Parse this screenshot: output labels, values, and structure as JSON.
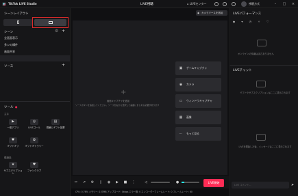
{
  "titlebar": {
    "app_name": "TikTok LIVE Studio",
    "center_title": "LIVE視聴",
    "live_center": "LIVEセンター",
    "user_label": "視聴方式"
  },
  "left": {
    "scene_layout_title": "シーンレイアウト",
    "scene_title": "シーン",
    "scenes": [
      "全画面表示",
      "多シの構件",
      "画面共享"
    ],
    "source_title": "ソース",
    "tools_title": "ツール",
    "tools_group1_title": "主な",
    "tools_group2_title": "推薦機",
    "tools_group3_title": "鑑通話",
    "tools": [
      {
        "label": "一般アプリ",
        "icon": "gamepad-icon"
      },
      {
        "label": "LIVEゴール",
        "icon": "target-icon"
      },
      {
        "label": "視聴とギフト投票",
        "icon": "poll-icon"
      },
      {
        "label": "ギフトギフ",
        "icon": "gift-icon"
      },
      {
        "label": "ギフトギャラリー",
        "icon": "gallery-icon"
      },
      {
        "label": "サブスクリプション",
        "icon": "subscription-icon"
      },
      {
        "label": "ファンクラブ",
        "icon": "fanclub-icon"
      }
    ]
  },
  "stage": {
    "copy_btn": "カメラソースを追加",
    "add_source_title": "画面キャプチャを追加",
    "add_source_desc": "ソースボタンを追加してください。ソースを右から選択して画面にまとめる必要があります",
    "add_buttons": [
      "ゲームキャプチャ",
      "カメラ",
      "ウィンドウキャプチャ",
      "画像",
      "もっと見る"
    ],
    "live_button": "LIVE開始",
    "status": "CPU: 0.76% メモリー: 157MB アップロード: 0kbps エラー数: 0 エンコーダーフレームレート: 0 フレームレート: 60"
  },
  "right": {
    "perf_title": "LIVEパフォーマンス",
    "perf_empty": "オンラインの情報はまだありません",
    "chat_title": "LIVEチャット",
    "chat_empty": "ギフトやサブスクリプションはここに表示されます",
    "chat_empty2": "LIVEを開始した後、メッセージはここに表示されます",
    "chat_input_placeholder": "LIVE コメント..."
  },
  "colors": {
    "accent": "#fe2c55",
    "highlight": "#d92b2b",
    "panel": "#161618",
    "canvas": "#1c1c1f"
  }
}
